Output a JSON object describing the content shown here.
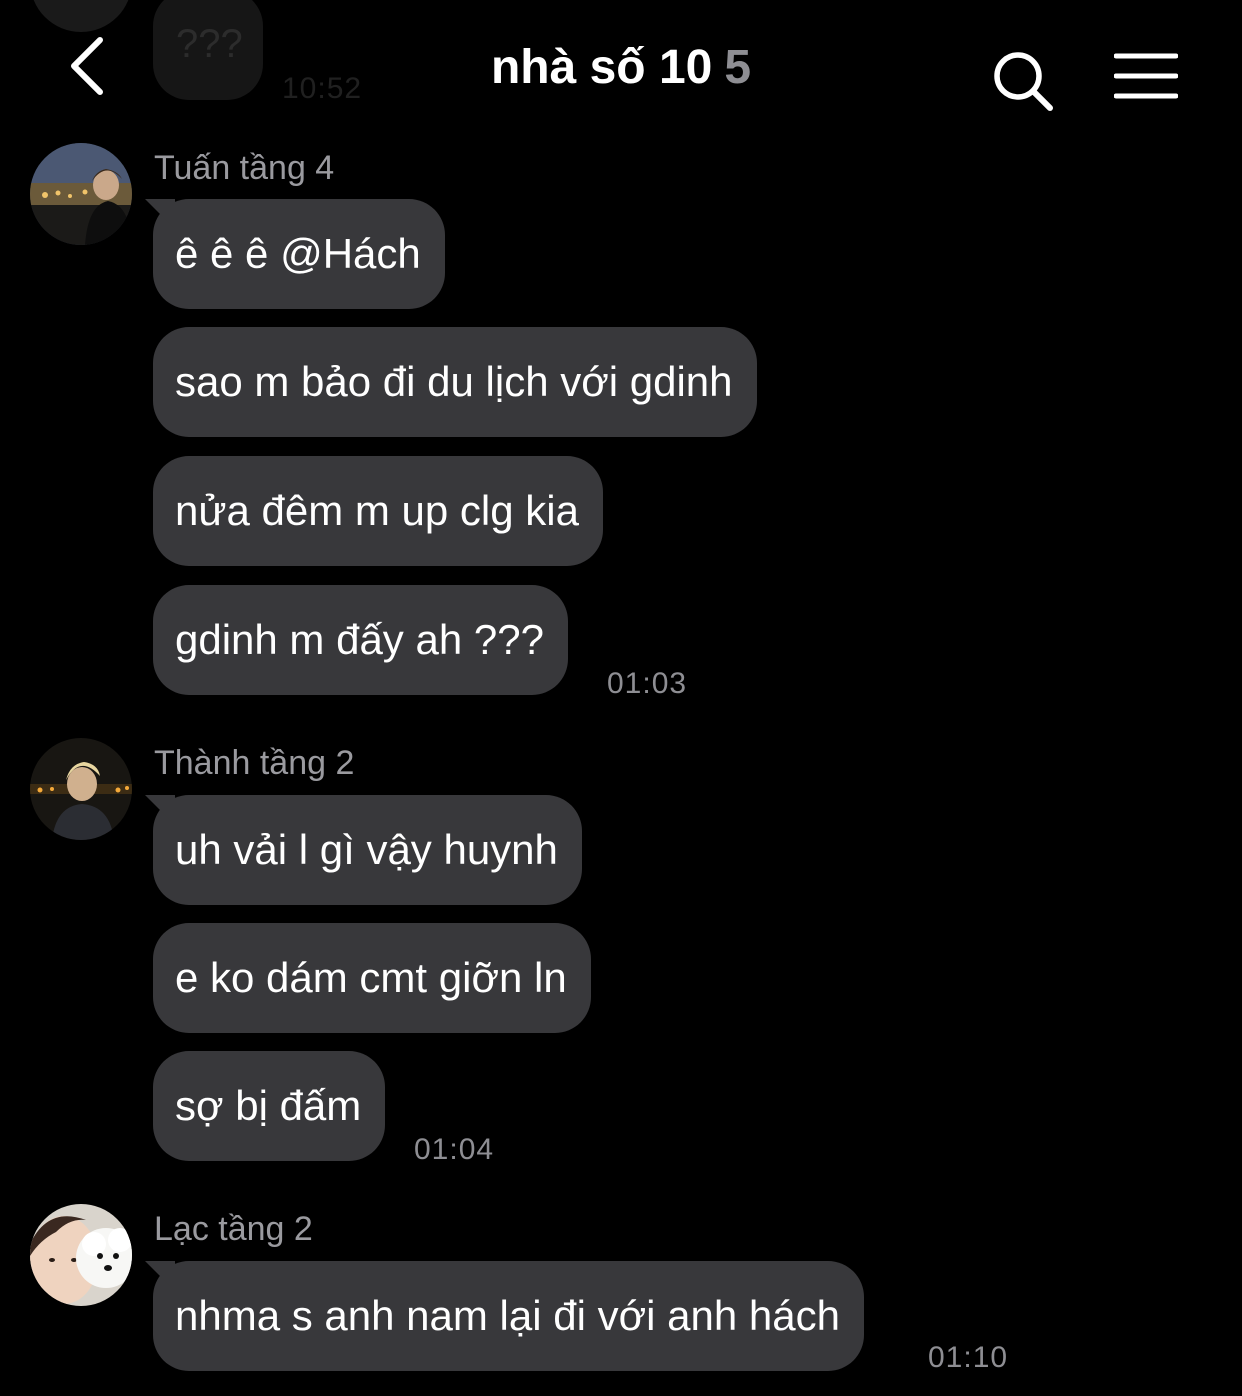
{
  "previous": {
    "text": "???",
    "time": "10:52"
  },
  "header": {
    "title": "nhà số 10",
    "member_count": "5",
    "back_icon": "chevron-left-icon",
    "search_icon": "search-icon",
    "menu_icon": "hamburger-menu-icon"
  },
  "groups": [
    {
      "sender": "Tuấn tầng 4",
      "messages": [
        "ê ê ê @Hách",
        "sao m bảo đi du lịch với gdinh",
        "nửa đêm m up clg kia",
        "gdinh m đấy ah ???"
      ],
      "time": "01:03"
    },
    {
      "sender": "Thành tầng 2",
      "messages": [
        "uh vải l gì vậy huynh",
        "e ko dám cmt giỡn ln",
        "sợ bị đấm"
      ],
      "time": "01:04"
    },
    {
      "sender": "Lạc tầng 2",
      "messages": [
        "nhma s anh nam lại đi với anh hách"
      ],
      "time": "01:10"
    }
  ],
  "colors": {
    "background": "#000000",
    "bubble": "#38383b",
    "secondary_text": "#8e8e93"
  }
}
